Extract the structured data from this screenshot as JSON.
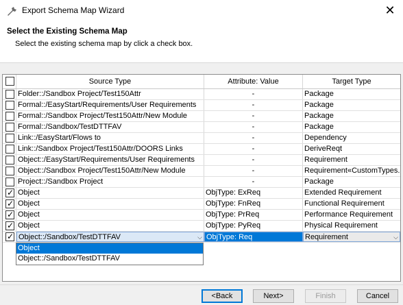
{
  "window": {
    "title": "Export Schema Map Wizard",
    "close_glyph": "✕",
    "app_icon": "wrench-icon"
  },
  "header": {
    "title": "Select the Existing Schema Map",
    "description": "Select the existing schema map by click a check box."
  },
  "table": {
    "columns": {
      "source": "Source Type",
      "attribute": "Attribute: Value",
      "target": "Target Type"
    },
    "rows": [
      {
        "checked": false,
        "source": "Folder::/Sandbox Project/Test150Attr",
        "attribute": "-",
        "target": "Package"
      },
      {
        "checked": false,
        "source": "Formal::/EasyStart/Requirements/User Requirements",
        "attribute": "-",
        "target": "Package"
      },
      {
        "checked": false,
        "source": "Formal::/Sandbox Project/Test150Attr/New Module",
        "attribute": "-",
        "target": "Package"
      },
      {
        "checked": false,
        "source": "Formal::/Sandbox/TestDTTFAV",
        "attribute": "-",
        "target": "Package"
      },
      {
        "checked": false,
        "source": "Link::/EasyStart/Flows to",
        "attribute": "-",
        "target": "Dependency"
      },
      {
        "checked": false,
        "source": "Link::/Sandbox Project/Test150Attr/DOORS Links",
        "attribute": "-",
        "target": "DeriveReqt"
      },
      {
        "checked": false,
        "source": "Object::/EasyStart/Requirements/User Requirements",
        "attribute": "-",
        "target": "Requirement"
      },
      {
        "checked": false,
        "source": "Object::/Sandbox Project/Test150Attr/New Module",
        "attribute": "-",
        "target": "Requirement«CustomTypes..."
      },
      {
        "checked": false,
        "source": "Project::/Sandbox Project",
        "attribute": "-",
        "target": "Package"
      },
      {
        "checked": true,
        "source": "Object",
        "attribute": "ObjType: ExReq",
        "target": "Extended Requirement"
      },
      {
        "checked": true,
        "source": "Object",
        "attribute": "ObjType: FnReq",
        "target": "Functional Requirement"
      },
      {
        "checked": true,
        "source": "Object",
        "attribute": "ObjType: PrReq",
        "target": "Performance Requirement"
      },
      {
        "checked": true,
        "source": "Object",
        "attribute": "ObjType: PyReq",
        "target": "Physical Requirement"
      },
      {
        "checked": true,
        "source": "Object::/Sandbox/TestDTTFAV",
        "attribute": "ObjType: Req",
        "target": "Requirement"
      }
    ],
    "tick_glyph": "✓",
    "dropdown_glyph": "⌵",
    "dropdown_options": [
      "Object",
      "Object::/Sandbox/TestDTTFAV"
    ]
  },
  "buttons": {
    "back": "<Back",
    "next": "Next>",
    "finish": "Finish",
    "cancel": "Cancel"
  },
  "colors": {
    "selection": "#0078d7",
    "primary_border": "#0078d7"
  }
}
